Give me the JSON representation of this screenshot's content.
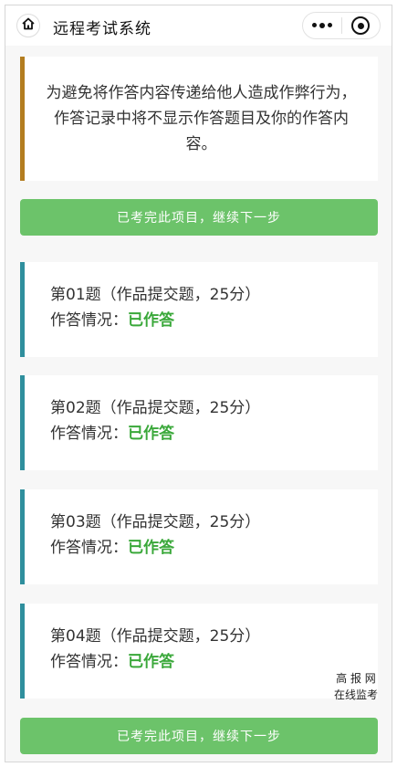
{
  "header": {
    "title": "远程考试系统",
    "home_icon": "home-icon",
    "more_icon": "more-dots-icon",
    "close_icon": "target-close-icon"
  },
  "notice": {
    "text": "为避免将作答内容传递给他人造成作弊行为，作答记录中将不显示作答题目及你的作答内容。",
    "accent_color": "#b37d20"
  },
  "next_button": {
    "label": "已考完此项目，继续下一步",
    "color": "#6cc36a"
  },
  "questions": [
    {
      "title": "第01题（作品提交题，25分）",
      "status_label": "作答情况：",
      "status_value": "已作答"
    },
    {
      "title": "第02题（作品提交题，25分）",
      "status_label": "作答情况：",
      "status_value": "已作答"
    },
    {
      "title": "第03题（作品提交题，25分）",
      "status_label": "作答情况：",
      "status_value": "已作答"
    },
    {
      "title": "第04题（作品提交题，25分）",
      "status_label": "作答情况：",
      "status_value": "已作答"
    }
  ],
  "card_accent_color": "#2f8f9d",
  "status_color": "#3aa83a",
  "watermark": {
    "line1": "高 报 网",
    "line2": "在线监考"
  }
}
